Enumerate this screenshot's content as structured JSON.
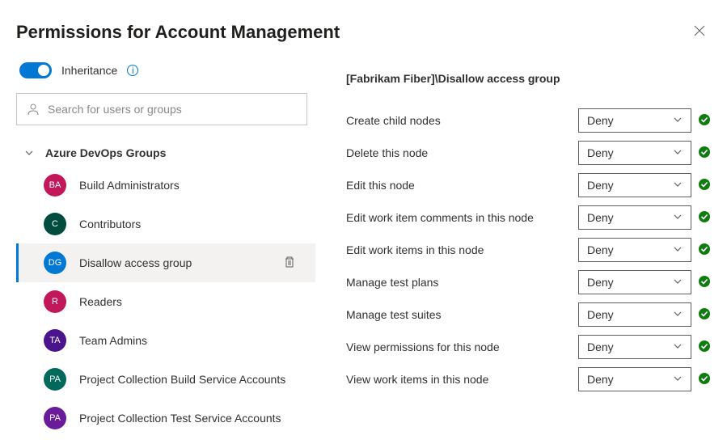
{
  "header": {
    "title": "Permissions for Account Management"
  },
  "left": {
    "inheritance_label": "Inheritance",
    "search_placeholder": "Search for users or groups",
    "section_title": "Azure DevOps Groups",
    "groups": [
      {
        "initials": "BA",
        "label": "Build Administrators",
        "color": "#c2185b",
        "selected": false
      },
      {
        "initials": "C",
        "label": "Contributors",
        "color": "#004d40",
        "selected": false
      },
      {
        "initials": "DG",
        "label": "Disallow access group",
        "color": "#0078d4",
        "selected": true
      },
      {
        "initials": "R",
        "label": "Readers",
        "color": "#c2185b",
        "selected": false
      },
      {
        "initials": "TA",
        "label": "Team Admins",
        "color": "#4a148c",
        "selected": false
      },
      {
        "initials": "PA",
        "label": "Project Collection Build Service Accounts",
        "color": "#00695c",
        "selected": false
      },
      {
        "initials": "PA",
        "label": "Project Collection Test Service Accounts",
        "color": "#6a1b9a",
        "selected": false
      }
    ]
  },
  "right": {
    "title": "[Fabrikam Fiber]\\Disallow access group",
    "permissions": [
      {
        "label": "Create child nodes",
        "value": "Deny"
      },
      {
        "label": "Delete this node",
        "value": "Deny"
      },
      {
        "label": "Edit this node",
        "value": "Deny"
      },
      {
        "label": "Edit work item comments in this node",
        "value": "Deny"
      },
      {
        "label": "Edit work items in this node",
        "value": "Deny"
      },
      {
        "label": "Manage test plans",
        "value": "Deny"
      },
      {
        "label": "Manage test suites",
        "value": "Deny"
      },
      {
        "label": "View permissions for this node",
        "value": "Deny"
      },
      {
        "label": "View work items in this node",
        "value": "Deny"
      }
    ]
  }
}
